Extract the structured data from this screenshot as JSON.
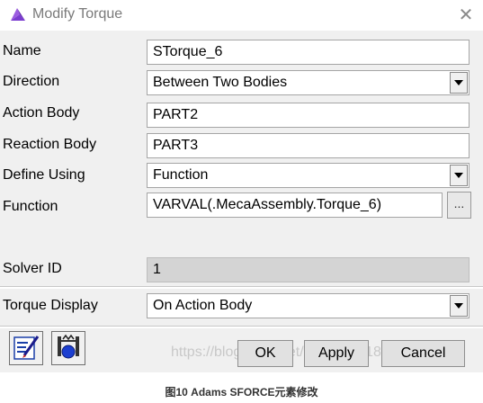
{
  "window": {
    "title": "Modify Torque",
    "close_glyph": "✕",
    "app_icon": "adams-logo-icon"
  },
  "form": {
    "name": {
      "label": "Name",
      "value": "STorque_6"
    },
    "direction": {
      "label": "Direction",
      "value": "Between Two Bodies"
    },
    "action_body": {
      "label": "Action Body",
      "value": "PART2"
    },
    "reaction_body": {
      "label": "Reaction Body",
      "value": "PART3"
    },
    "define_using": {
      "label": "Define Using",
      "value": "Function"
    },
    "function": {
      "label": "Function",
      "value": "VARVAL(.MecaAssembly.Torque_6)",
      "browse_label": "..."
    },
    "solver_id": {
      "label": "Solver ID",
      "value": "1"
    },
    "torque_display": {
      "label": "Torque Display",
      "value": "On Action Body"
    }
  },
  "buttons": {
    "ok": "OK",
    "apply": "Apply",
    "cancel": "Cancel"
  },
  "tool_icons": [
    "edit-list-icon",
    "torque-function-icon"
  ],
  "watermark": "https://blog.csdn.net/wangl_2018?98",
  "caption": "图10 Adams SFORCE元素修改",
  "colors": {
    "accent": "#6a2bbf",
    "dialog_bg": "#f0f0f0"
  }
}
